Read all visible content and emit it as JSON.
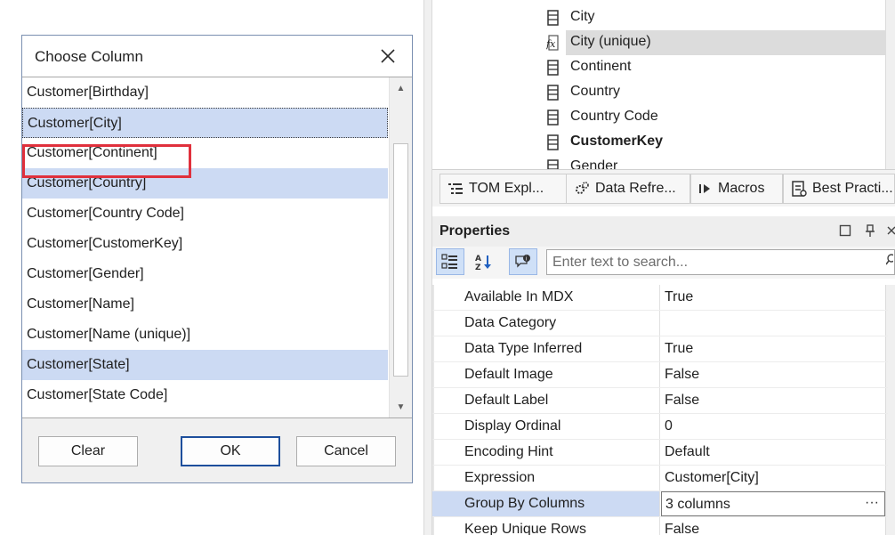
{
  "dialog": {
    "title": "Choose Column",
    "items": [
      {
        "label": "Customer[Birthday]",
        "selected": false
      },
      {
        "label": "Customer[City]",
        "selected": true,
        "focused": true,
        "highlighted": true
      },
      {
        "label": "Customer[Continent]",
        "selected": false
      },
      {
        "label": "Customer[Country]",
        "selected": true
      },
      {
        "label": "Customer[Country Code]",
        "selected": false
      },
      {
        "label": "Customer[CustomerKey]",
        "selected": false
      },
      {
        "label": "Customer[Gender]",
        "selected": false
      },
      {
        "label": "Customer[Name]",
        "selected": false
      },
      {
        "label": "Customer[Name (unique)]",
        "selected": false
      },
      {
        "label": "Customer[State]",
        "selected": true
      },
      {
        "label": "Customer[State Code]",
        "selected": false
      }
    ],
    "buttons": {
      "clear": "Clear",
      "ok": "OK",
      "cancel": "Cancel"
    },
    "highlight_color": "#e0303c",
    "selection_color": "#ccdaf3"
  },
  "tree": {
    "items": [
      {
        "label": "City",
        "icon": "column-icon"
      },
      {
        "label": "City (unique)",
        "icon": "calculated-column-icon",
        "selected": true
      },
      {
        "label": "Continent",
        "icon": "column-icon"
      },
      {
        "label": "Country",
        "icon": "column-icon"
      },
      {
        "label": "Country Code",
        "icon": "column-icon"
      },
      {
        "label": "CustomerKey",
        "icon": "column-icon",
        "bold": true
      },
      {
        "label": "Gender",
        "icon": "column-icon"
      }
    ]
  },
  "tabs": [
    {
      "label": "TOM Expl...",
      "icon": "tree-icon"
    },
    {
      "label": "Data Refre...",
      "icon": "gears-icon"
    },
    {
      "label": "Macros",
      "icon": "play-icon"
    },
    {
      "label": "Best Practi...",
      "icon": "checklist-icon"
    }
  ],
  "properties": {
    "title": "Properties",
    "search_placeholder": "Enter text to search...",
    "rows": [
      {
        "name": "Available In MDX",
        "value": "True"
      },
      {
        "name": "Data Category",
        "value": ""
      },
      {
        "name": "Data Type Inferred",
        "value": "True"
      },
      {
        "name": "Default Image",
        "value": "False"
      },
      {
        "name": "Default Label",
        "value": "False"
      },
      {
        "name": "Display Ordinal",
        "value": "0"
      },
      {
        "name": "Encoding Hint",
        "value": "Default"
      },
      {
        "name": "Expression",
        "value": "Customer[City]"
      },
      {
        "name": "Group By Columns",
        "value": "3 columns",
        "selected": true
      },
      {
        "name": "Keep Unique Rows",
        "value": "False"
      }
    ],
    "ellipsis": "···"
  }
}
